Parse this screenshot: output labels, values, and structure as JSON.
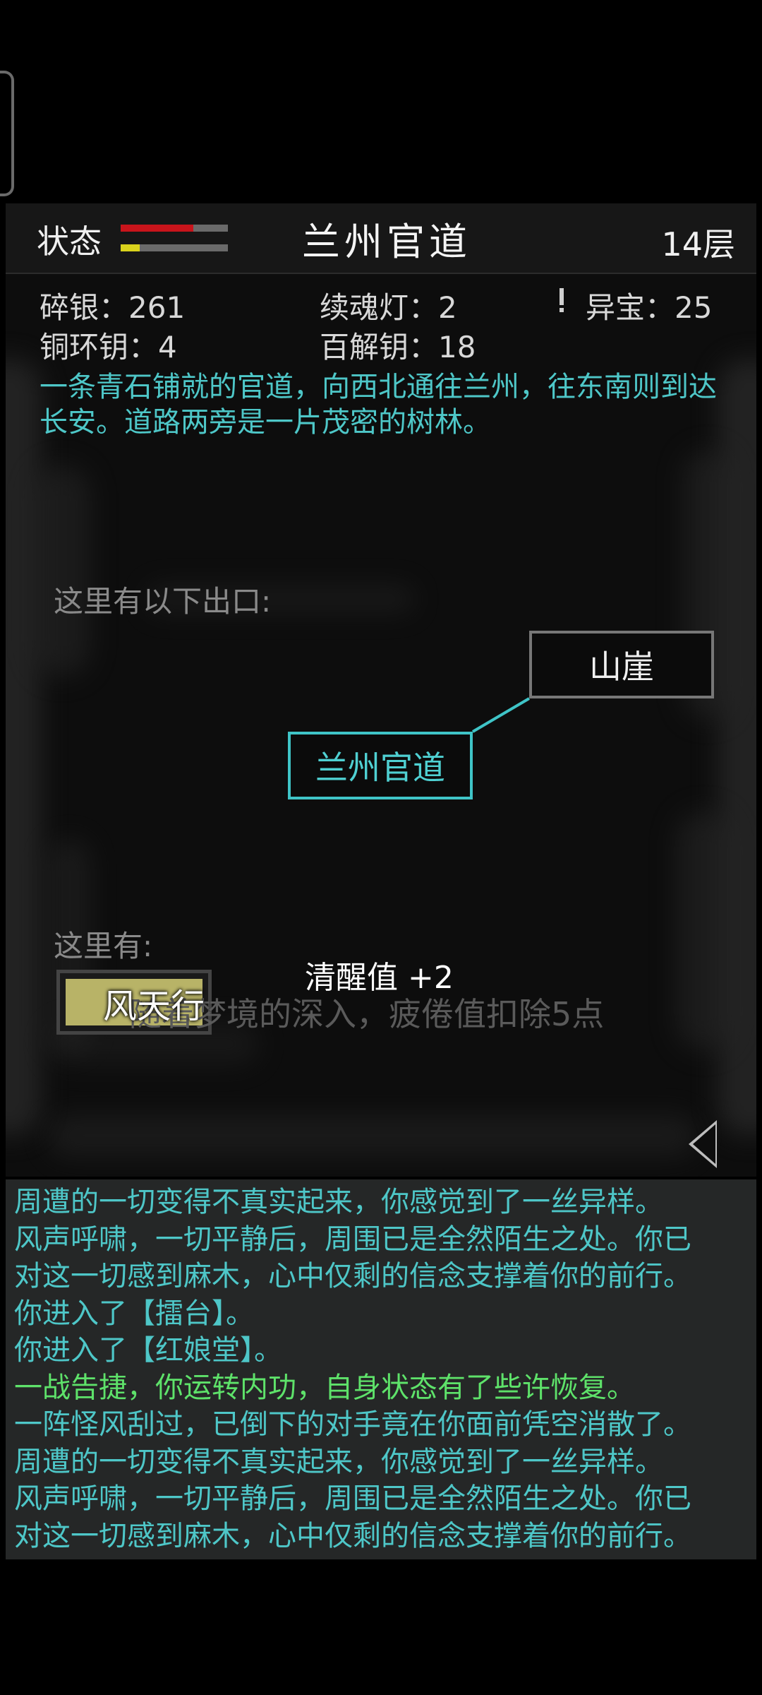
{
  "header": {
    "status_label": "状态",
    "location_title": "兰州官道",
    "floor": "14层",
    "hp_fraction": 0.68,
    "energy_fraction": 0.18,
    "hp_color": "#c8141b",
    "energy_color": "#d9d21c"
  },
  "resources": {
    "silver": "碎银：261",
    "soul_lamp": "续魂灯：2",
    "treasure_icon": "exclamation-icon",
    "treasure": "异宝：25",
    "copper_key": "铜环钥：4",
    "master_key": "百解钥：18"
  },
  "description": "一条青石铺就的官道，向西北通往兰州，往东南则到达长安。道路两旁是一片茂密的树林。",
  "exits": {
    "heading": "这里有以下出口:",
    "nodes": [
      "山崖",
      "兰州官道"
    ]
  },
  "here": {
    "heading": "这里有:",
    "npc_name": "风天行",
    "float_text": "清醒值 +2",
    "notice": "随着梦境的深入，疲倦值扣除5点"
  },
  "back_icon": "triangle-left-icon",
  "log": [
    {
      "text": "周遭的一切变得不真实起来，你感觉到了一丝异样。",
      "type": "normal"
    },
    {
      "text": "风声呼啸，一切平静后，周围已是全然陌生之处。你已",
      "type": "normal"
    },
    {
      "text": "对这一切感到麻木，心中仅剩的信念支撑着你的前行。",
      "type": "normal"
    },
    {
      "text": "你进入了【擂台】。",
      "type": "normal"
    },
    {
      "text": "你进入了【红娘堂】。",
      "type": "normal"
    },
    {
      "text": "一战告捷，你运转内功，自身状态有了些许恢复。",
      "type": "win"
    },
    {
      "text": "一阵怪风刮过，已倒下的对手竟在你面前凭空消散了。",
      "type": "normal"
    },
    {
      "text": "周遭的一切变得不真实起来，你感觉到了一丝异样。",
      "type": "normal"
    },
    {
      "text": "风声呼啸，一切平静后，周围已是全然陌生之处。你已",
      "type": "normal"
    },
    {
      "text": "对这一切感到麻木，心中仅剩的信念支撑着你的前行。",
      "type": "normal"
    }
  ]
}
